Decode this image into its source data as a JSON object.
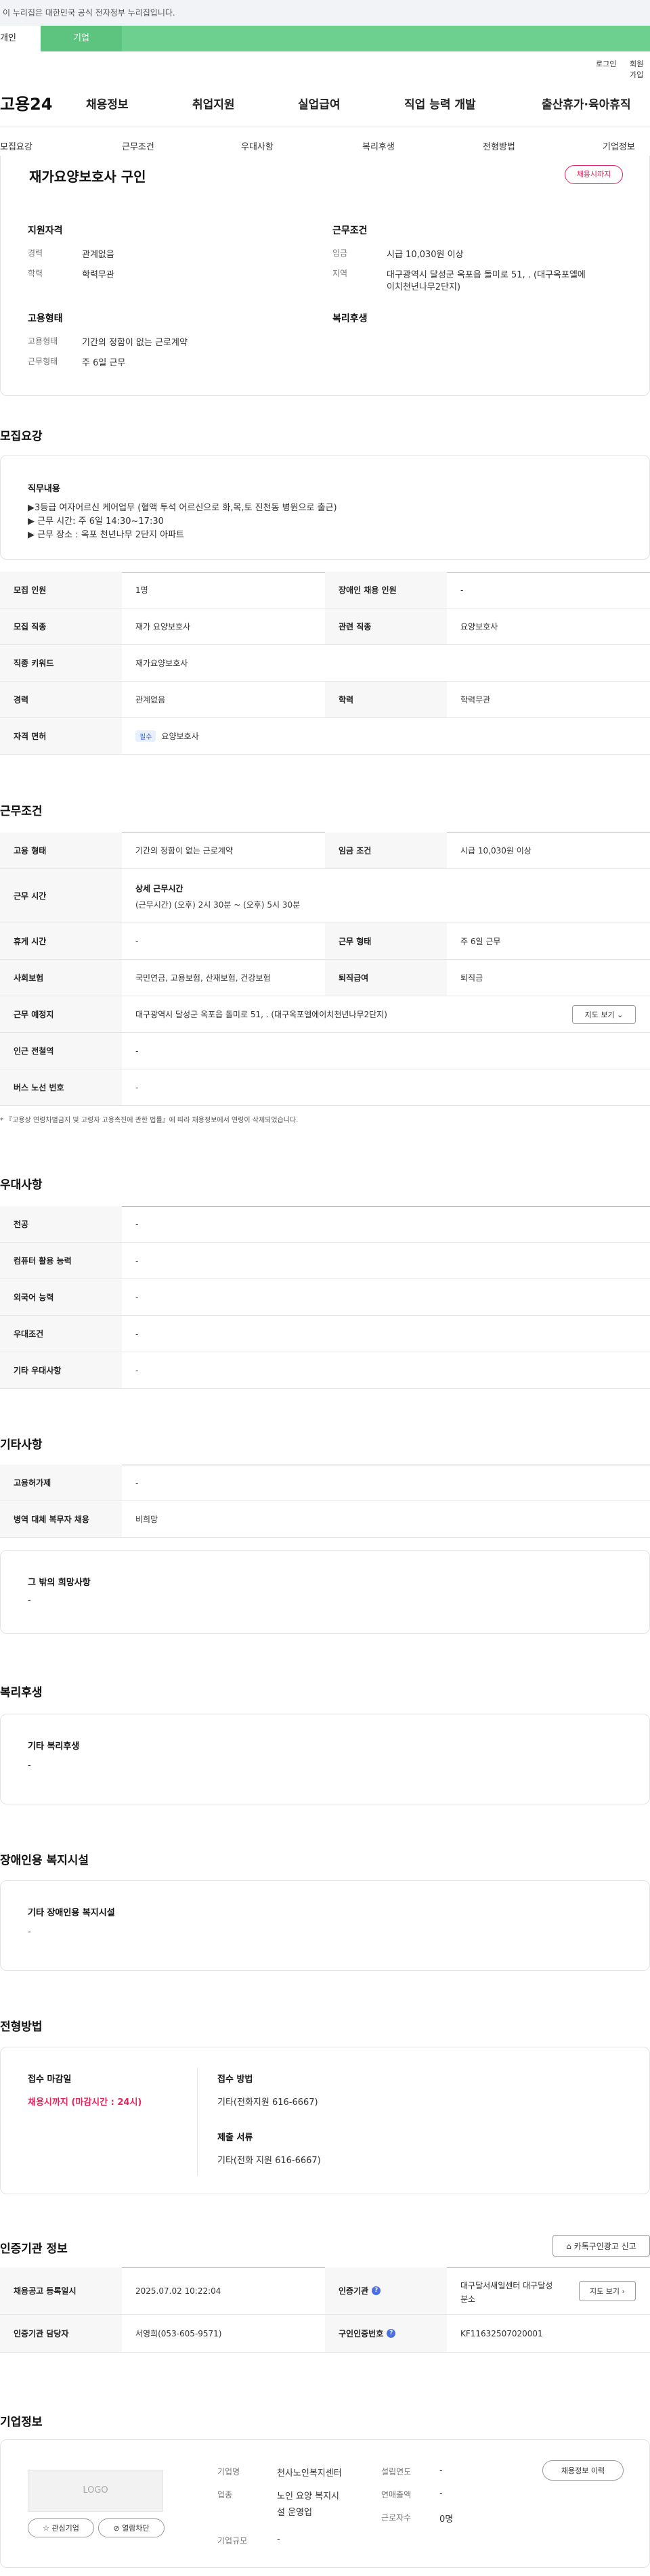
{
  "gov_banner": "이 누리집은 대한민국 공식 전자정부 누리집입니다.",
  "user_tabs": {
    "personal": "개인",
    "company": "기업"
  },
  "util": {
    "login": "로그인",
    "join": "회원가입"
  },
  "logo": "고용24",
  "gnb": [
    "채용정보",
    "취업지원",
    "실업급여",
    "직업 능력 개발",
    "출산휴가·육아휴직"
  ],
  "lnb": [
    "모집요강",
    "근무조건",
    "우대사항",
    "복리후생",
    "전형방법",
    "기업정보"
  ],
  "summary": {
    "title": "재가요양보호사 구인",
    "badge": "채용시까지",
    "qual_title": "지원자격",
    "exp_label": "경력",
    "exp_value": "관계없음",
    "edu_label": "학력",
    "edu_value": "학력무관",
    "cond_title": "근무조건",
    "wage_label": "임금",
    "wage_value": "시급 10,030원 이상",
    "region_label": "지역",
    "region_value1": "대구광역시 달성군 옥포읍 돌미로 51, . (대구옥포엘에",
    "region_value2": "이치천년나무2단지)",
    "emp_title": "고용형태",
    "emp_label": "고용형태",
    "emp_value": "기간의 정함이 없는 근로계약",
    "form_label": "근무형태",
    "form_value": "주 6일 근무",
    "welfare_title": "복리후생"
  },
  "recruit": {
    "section_title": "모집요강",
    "duty_title": "직무내용",
    "duty_lines": [
      "▶3등급 여자어르신 케어업무 (혈액 투석 어르신으로 화,목,토 진천동 병원으로 출근)",
      "▶ 근무 시간:  주 6일 14:30~17:30",
      "▶ 근무 장소 : 옥포 천년나무 2단지 아파트"
    ],
    "rows": [
      {
        "k1": "모집 인원",
        "v1": "1명",
        "k2": "장애인 채용 인원",
        "v2": "-"
      },
      {
        "k1": "모집 직종",
        "v1": "재가 요양보호사",
        "k2": "관련 직종",
        "v2": "요양보호사"
      },
      {
        "k1": "직종 키워드",
        "v1": "재가요양보호사"
      },
      {
        "k1": "경력",
        "v1": "관계없음",
        "k2": "학력",
        "v2": "학력무관"
      },
      {
        "k1": "자격 면허",
        "req": "필수",
        "v1": "요양보호사"
      }
    ]
  },
  "work": {
    "section_title": "근무조건",
    "r1": {
      "k1": "고용 형태",
      "v1": "기간의 정함이 없는 근로계약",
      "k2": "임금 조건",
      "v2": "시급 10,030원 이상"
    },
    "r2": {
      "k1": "근무 시간",
      "t1": "상세 근무시간",
      "t2": "(근무시간) (오후) 2시 30분 ~ (오후) 5시 30분"
    },
    "r3": {
      "k1": "휴게 시간",
      "v1": "-",
      "k2": "근무 형태",
      "v2": "주 6일 근무"
    },
    "r4": {
      "k1": "사회보험",
      "v1": "국민연금, 고용보험, 산재보험, 건강보험",
      "k2": "퇴직급여",
      "v2": "퇴직금"
    },
    "r5": {
      "k1": "근무 예정지",
      "v1": "대구광역시 달성군 옥포읍 돌미로 51, . (대구옥포엘에이치천년나무2단지)",
      "btn": "지도 보기"
    },
    "r6": {
      "k1": "인근 전철역",
      "v1": "-"
    },
    "r7": {
      "k1": "버스 노선 번호",
      "v1": "-"
    },
    "note": "* 『고용상 연령차별금지 및 고령자 고용촉진에 관한 법률』에 따라 채용정보에서 연령이 삭제되었습니다."
  },
  "pref": {
    "section_title": "우대사항",
    "rows": [
      {
        "k": "전공",
        "v": "-"
      },
      {
        "k": "컴퓨터 활용 능력",
        "v": "-"
      },
      {
        "k": "외국어 능력",
        "v": "-"
      },
      {
        "k": "우대조건",
        "v": "-"
      },
      {
        "k": "기타 우대사항",
        "v": "-"
      }
    ]
  },
  "etc": {
    "section_title": "기타사항",
    "rows": [
      {
        "k": "고용허가제",
        "v": "-"
      },
      {
        "k": "병역 대체 복무자 채용",
        "v": "비희망"
      }
    ],
    "hope_title": "그 밖의 희망사항",
    "hope_value": "-"
  },
  "welfare": {
    "section_title": "복리후생",
    "card_title": "기타 복리후생",
    "card_value": "-"
  },
  "disability": {
    "section_title": "장애인용 복지시설",
    "card_title": "기타 장애인용 복지시설",
    "card_value": "-"
  },
  "selection": {
    "section_title": "전형방법",
    "deadline_title": "접수 마감일",
    "deadline_value": "채용시까지 (마감시간 : 24시)",
    "method_title": "접수 방법",
    "method_value": "기타(전화지원 616-6667)",
    "docs_title": "제출 서류",
    "docs_value": "기타(전화 지원 616-6667)"
  },
  "cert": {
    "section_title": "인증기관 정보",
    "kakao_btn": "카톡구인광고 신고",
    "r1": {
      "k1": "채용공고 등록일시",
      "v1": "2025.07.02 10:22:04",
      "k2": "인증기관",
      "v2a": "대구달서새일센터 대구달성",
      "v2b": "분소",
      "btn": "지도 보기"
    },
    "r2": {
      "k1": "인증기관 담당자",
      "v1": "서영희(053-605-9571)",
      "k2": "구인인증번호",
      "v2": "KF11632507020001"
    }
  },
  "company": {
    "section_title": "기업정보",
    "logo_text": "LOGO",
    "fav_btn": "관심기업",
    "block_btn": "열람차단",
    "history_btn": "채용정보 이력",
    "name_label": "기업명",
    "name_value": "천사노인복지센터",
    "industry_label": "업종",
    "industry_value1": "노인 요양 복지시",
    "industry_value2": "설 운영업",
    "size_label": "기업규모",
    "size_value": "-",
    "est_label": "설립연도",
    "est_value": "-",
    "sales_label": "연매출액",
    "sales_value": "-",
    "emp_label": "근로자수",
    "emp_value": "0명"
  }
}
